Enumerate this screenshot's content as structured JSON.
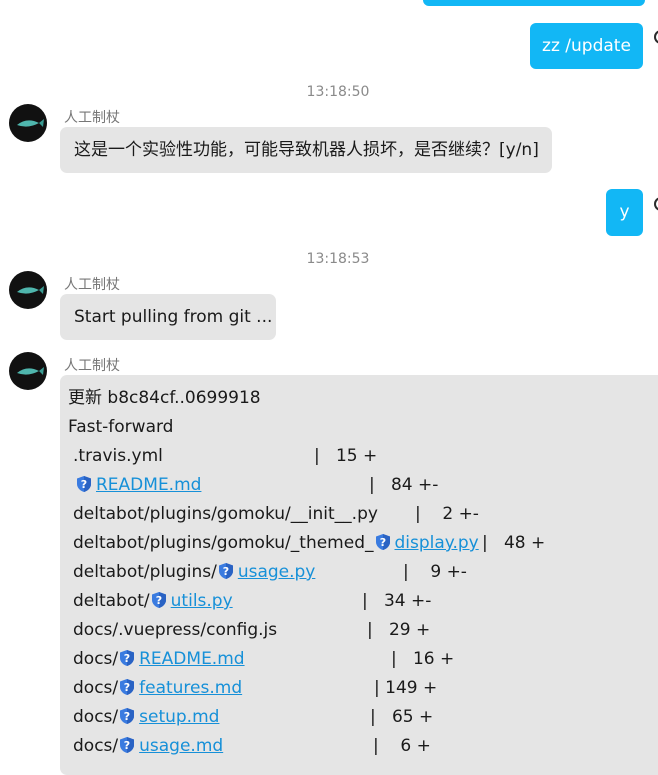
{
  "colors": {
    "outgoing_bubble": "#12b7f5",
    "incoming_bubble": "#e5e5e5",
    "link": "#1690d8"
  },
  "messages": {
    "out_update": "zz /update",
    "time1": "13:18:50",
    "bot_name_1": "人工制杖",
    "warning": "这是一个实验性功能，可能导致机器人损坏，是否继续？[y/n]",
    "out_yes": "y",
    "time2": "13:18:53",
    "bot_name_2": "人工制杖",
    "pulling": "Start pulling from git ...",
    "bot_name_3": "人工制杖"
  },
  "git_output": {
    "header1": "更新 b8c84cf..0699918",
    "header2": "Fast-forward",
    "files": [
      {
        "prefix": ".travis.yml",
        "link": "",
        "stat": "|   15 +"
      },
      {
        "prefix": "",
        "link": "README.md",
        "stat": "|   84 +-"
      },
      {
        "prefix": "deltabot/plugins/gomoku/__init__.py",
        "link": "",
        "stat": "|    2 +-"
      },
      {
        "prefix": "deltabot/plugins/gomoku/_themed_",
        "link": "display.py",
        "stat": "|   48 +"
      },
      {
        "prefix": "deltabot/plugins/",
        "link": "usage.py",
        "stat": "|    9 +-"
      },
      {
        "prefix": "deltabot/",
        "link": "utils.py",
        "stat": "|   34 +-"
      },
      {
        "prefix": "docs/.vuepress/config.js",
        "link": "",
        "stat": "|   29 +"
      },
      {
        "prefix": "docs/",
        "link": "README.md",
        "stat": "|   16 +"
      },
      {
        "prefix": "docs/",
        "link": "features.md",
        "stat": "| 149 +"
      },
      {
        "prefix": "docs/",
        "link": "setup.md",
        "stat": "|   65 +"
      },
      {
        "prefix": "docs/",
        "link": "usage.md",
        "stat": "|    6 +"
      }
    ]
  }
}
